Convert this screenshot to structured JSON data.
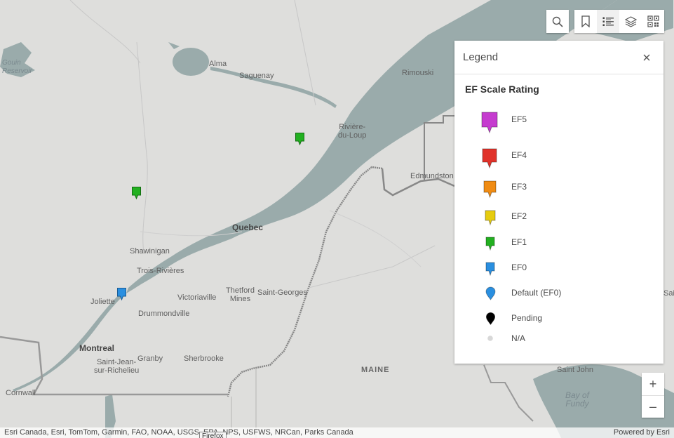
{
  "map": {
    "places": [
      {
        "id": "gouin",
        "text": "Gouin\nReservoir",
        "kind": "water"
      },
      {
        "id": "alma",
        "text": "Alma",
        "kind": "town"
      },
      {
        "id": "saguenay",
        "text": "Saguenay",
        "kind": "town"
      },
      {
        "id": "rimouski",
        "text": "Rimouski",
        "kind": "town"
      },
      {
        "id": "riviere",
        "text": "Rivière-\ndu-Loup",
        "kind": "town"
      },
      {
        "id": "edmundston",
        "text": "Edmundston",
        "kind": "town"
      },
      {
        "id": "quebec",
        "text": "Quebec",
        "kind": "city"
      },
      {
        "id": "shawinigan",
        "text": "Shawinigan",
        "kind": "town"
      },
      {
        "id": "trois",
        "text": "Trois-Rivières",
        "kind": "town"
      },
      {
        "id": "victoriaville",
        "text": "Victoriaville",
        "kind": "town"
      },
      {
        "id": "thetford",
        "text": "Thetford\nMines",
        "kind": "town"
      },
      {
        "id": "saintgeorges",
        "text": "Saint-Georges",
        "kind": "town"
      },
      {
        "id": "joliette",
        "text": "Joliette",
        "kind": "town"
      },
      {
        "id": "drummondville",
        "text": "Drummondville",
        "kind": "town"
      },
      {
        "id": "montreal",
        "text": "Montreal",
        "kind": "city"
      },
      {
        "id": "saintjean",
        "text": "Saint-Jean-\nsur-Richelieu",
        "kind": "town"
      },
      {
        "id": "granby",
        "text": "Granby",
        "kind": "town"
      },
      {
        "id": "sherbrooke",
        "text": "Sherbrooke",
        "kind": "town"
      },
      {
        "id": "cornwall",
        "text": "Cornwall",
        "kind": "town"
      },
      {
        "id": "maine",
        "text": "MAINE",
        "kind": "state"
      },
      {
        "id": "saintjohn",
        "text": "Saint John",
        "kind": "town"
      },
      {
        "id": "fundy",
        "text": "Bay of\nFundy",
        "kind": "water"
      },
      {
        "id": "sjcut",
        "text": "Sain",
        "kind": "town"
      }
    ],
    "markers": [
      {
        "rating": "EF1",
        "color": "#22b020"
      },
      {
        "rating": "EF1",
        "color": "#22b020"
      },
      {
        "rating": "EF0",
        "color": "#2a8fe0"
      }
    ]
  },
  "toolbar": {
    "search_icon": "search-icon",
    "bookmarks_icon": "bookmark-icon",
    "legend_icon": "list-icon",
    "layers_icon": "layers-icon",
    "basemap_icon": "qr-grid-icon"
  },
  "legend": {
    "title": "Legend",
    "layer_title": "EF Scale Rating",
    "items": [
      {
        "label": "EF5",
        "color": "#c53ccf",
        "shape": "square-pin-large"
      },
      {
        "label": "EF4",
        "color": "#e0322a",
        "shape": "square-pin-large"
      },
      {
        "label": "EF3",
        "color": "#f08c14",
        "shape": "square-pin"
      },
      {
        "label": "EF2",
        "color": "#e6cc0e",
        "shape": "square-pin"
      },
      {
        "label": "EF1",
        "color": "#22b020",
        "shape": "square-pin-small"
      },
      {
        "label": "EF0",
        "color": "#2a8fe0",
        "shape": "square-pin-small"
      },
      {
        "label": "Default (EF0)",
        "color": "#2a8fe0",
        "shape": "round-pin"
      },
      {
        "label": "Pending",
        "color": "#000000",
        "shape": "round-pin"
      },
      {
        "label": "N/A",
        "color": "#d8d8d8",
        "shape": "dot"
      }
    ]
  },
  "zoom": {
    "in_label": "+",
    "out_label": "–"
  },
  "attribution": {
    "text": "Esri Canada, Esri, TomTom, Garmin, FAO, NOAA, USGS, EPA, NPS, USFWS, NRCan, Parks Canada",
    "powered": "Powered by Esri",
    "tooltip": "Firefox"
  }
}
